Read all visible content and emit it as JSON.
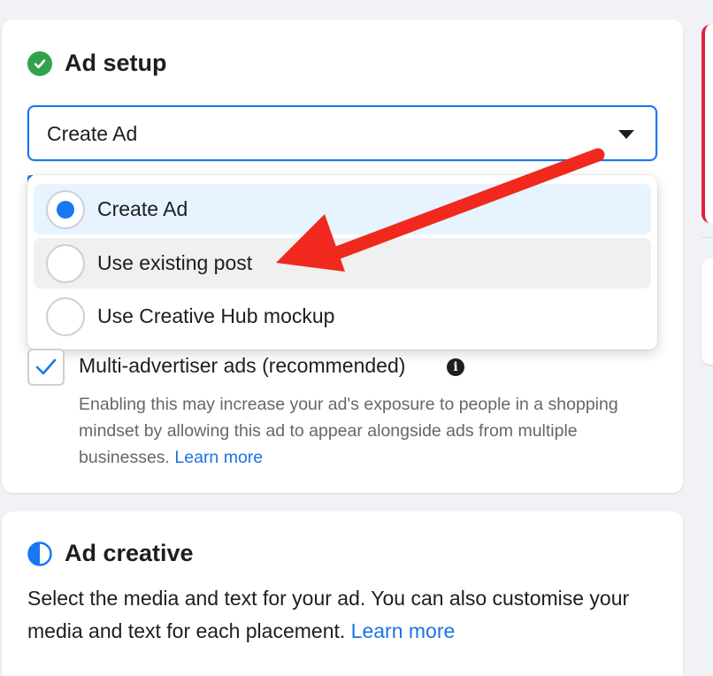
{
  "ad_setup": {
    "title": "Ad setup",
    "status_icon": "check-circle-icon",
    "select": {
      "value": "Create Ad",
      "options": [
        {
          "label": "Create Ad",
          "selected": true
        },
        {
          "label": "Use existing post",
          "selected": false
        },
        {
          "label": "Use Creative Hub mockup",
          "selected": false
        }
      ]
    },
    "multi_advertiser": {
      "checked": true,
      "label": "Multi-advertiser ads (recommended)",
      "info_icon": "info-icon",
      "description": "Enabling this may increase your ad's exposure to people in a shopping mindset by allowing this ad to appear alongside ads from multiple businesses.",
      "learn_more": "Learn more"
    }
  },
  "ad_creative": {
    "title": "Ad creative",
    "status_icon": "half-circle-icon",
    "description": "Select the media and text for your ad. You can also customise your media and text for each placement.",
    "learn_more": "Learn more"
  },
  "colors": {
    "accent": "#1877f2",
    "success": "#31a24c",
    "link": "#1b74e4",
    "annotation_arrow": "#f0281e"
  }
}
